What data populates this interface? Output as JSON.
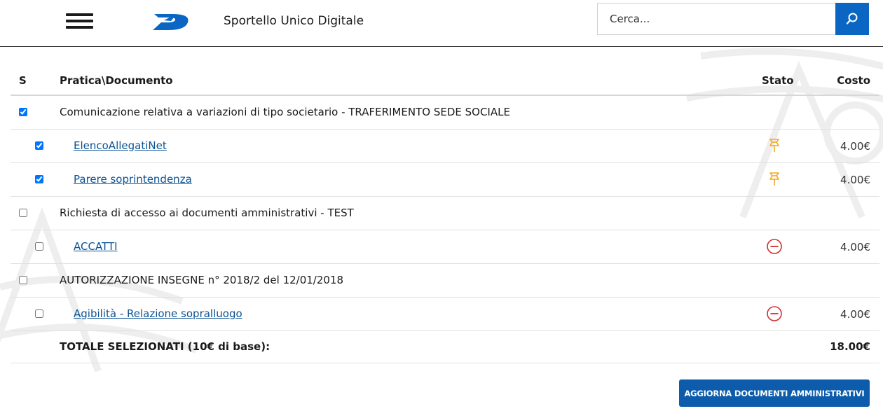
{
  "header": {
    "app_title": "Sportello Unico Digitale",
    "search_placeholder": "Cerca...",
    "accent_color": "#0a66c2"
  },
  "table": {
    "columns": {
      "select": "S",
      "document": "Pratica\\Documento",
      "status": "Stato",
      "cost": "Costo"
    },
    "rows": [
      {
        "type": "group",
        "checked": true,
        "label": "Comunicazione relativa a variazioni di tipo societario - TRAFERIMENTO SEDE SOCIALE",
        "status": "",
        "cost": ""
      },
      {
        "type": "child",
        "checked": true,
        "label": "ElencoAllegatiNet",
        "status": "pin-icon",
        "cost": "4.00€"
      },
      {
        "type": "child",
        "checked": true,
        "label": "Parere soprintendenza",
        "status": "pin-icon",
        "cost": "4.00€"
      },
      {
        "type": "group",
        "checked": false,
        "label": "Richiesta di accesso ai documenti amministrativi - TEST",
        "status": "",
        "cost": ""
      },
      {
        "type": "child",
        "checked": false,
        "label": "ACCATTI",
        "status": "minus-circle-icon",
        "cost": "4.00€"
      },
      {
        "type": "group",
        "checked": false,
        "label": "AUTORIZZAZIONE INSEGNE n° 2018/2 del 12/01/2018",
        "status": "",
        "cost": ""
      },
      {
        "type": "child",
        "checked": false,
        "label": "Agibilità - Relazione sopralluogo",
        "status": "minus-circle-icon",
        "cost": "4.00€"
      }
    ],
    "total": {
      "label": "TOTALE SELEZIONATI (10€ di base):",
      "value": "18.00€"
    }
  },
  "actions": {
    "update_label": "AGGIORNA DOCUMENTI AMMINISTRATIVI"
  },
  "colors": {
    "pin": "#f5a623",
    "minus": "#d32f2f",
    "link": "#0b5394",
    "button": "#0d5cab"
  }
}
